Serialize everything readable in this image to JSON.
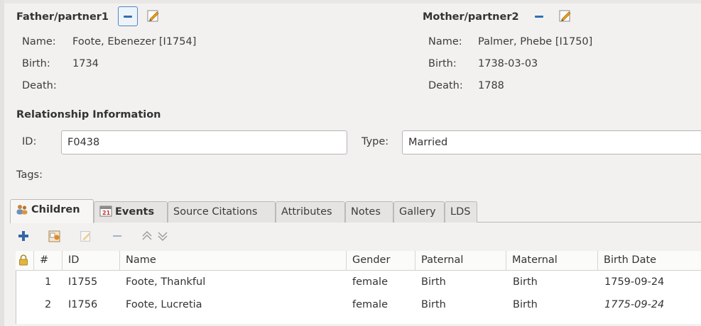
{
  "family": {
    "father": {
      "heading": "Father/partner1",
      "name_label": "Name:",
      "name": "Foote, Ebenezer [I1754]",
      "birth_label": "Birth:",
      "birth": "1734",
      "death_label": "Death:",
      "death": ""
    },
    "mother": {
      "heading": "Mother/partner2",
      "name_label": "Name:",
      "name": "Palmer, Phebe [I1750]",
      "birth_label": "Birth:",
      "birth": "1738-03-03",
      "death_label": "Death:",
      "death": "1788"
    }
  },
  "relationship": {
    "heading": "Relationship Information",
    "id_label": "ID:",
    "id_value": "F0438",
    "type_label": "Type:",
    "type_value": "Married",
    "tags_label": "Tags:"
  },
  "tabs": [
    {
      "label": "Children",
      "icon": "people-icon",
      "active": true
    },
    {
      "label": "Events",
      "icon": "calendar-icon"
    },
    {
      "label": "Source Citations"
    },
    {
      "label": "Attributes"
    },
    {
      "label": "Notes"
    },
    {
      "label": "Gallery"
    },
    {
      "label": "LDS"
    }
  ],
  "toolbar": [
    "add-icon",
    "share-existing-icon",
    "edit-icon",
    "remove-icon",
    "move-up-icon",
    "move-down-icon"
  ],
  "children_table": {
    "columns": [
      "#",
      "ID",
      "Name",
      "Gender",
      "Paternal",
      "Maternal",
      "Birth Date"
    ],
    "rows": [
      {
        "num": "1",
        "id": "I1755",
        "name": "Foote, Thankful",
        "gender": "female",
        "paternal": "Birth",
        "maternal": "Birth",
        "birth": "1759-09-24"
      },
      {
        "num": "2",
        "id": "I1756",
        "name": "Foote, Lucretia",
        "gender": "female",
        "paternal": "Birth",
        "maternal": "Birth",
        "birth": "1775-09-24"
      }
    ]
  },
  "colors": {
    "accent": "#2f6fb6",
    "tab_border": "#bdb9b5",
    "background": "#f2f1f0"
  }
}
